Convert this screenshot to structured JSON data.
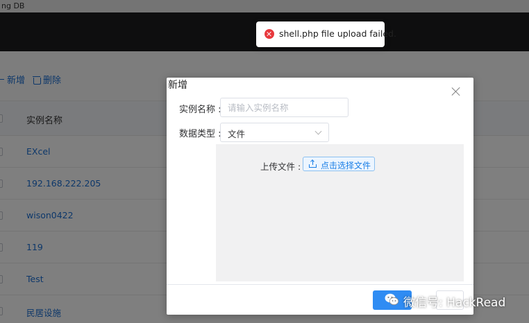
{
  "window": {
    "title": "ng DB"
  },
  "toolbar": {
    "add_label": "新增",
    "delete_label": "删除"
  },
  "table": {
    "column_header": "实例名称",
    "rows": [
      "EXcel",
      "192.168.222.205",
      "wison0422",
      "119",
      "Test",
      "民居设施"
    ]
  },
  "dialog": {
    "title": "新增",
    "name_label": "实例名称 :",
    "name_value": "",
    "name_placeholder": "请输入实例名称",
    "type_label": "数据类型 :",
    "type_value": "文件",
    "upload_label": "上传文件 :",
    "upload_button": "点击选择文件"
  },
  "toast": {
    "type": "error",
    "message": "shell.php file upload failed."
  },
  "watermark": {
    "text": "微信号: HackRead"
  },
  "colors": {
    "accent": "#1a6fd4",
    "error": "#e8383d",
    "primary_button": "#2f8cf3"
  }
}
